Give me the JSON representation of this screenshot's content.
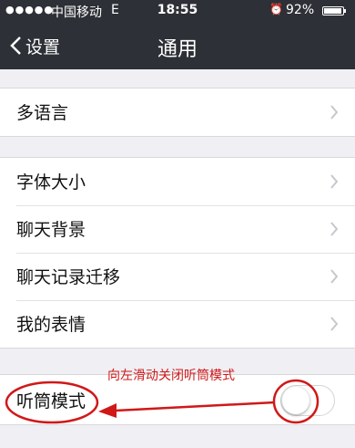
{
  "status_bar": {
    "signal": "●●●●●",
    "carrier": "中国移动",
    "network": "E",
    "time": "18:55",
    "alarm_icon": "alarm-clock-icon",
    "battery_percent": "92%",
    "battery_level": 0.92
  },
  "nav": {
    "back_label": "设置",
    "title": "通用"
  },
  "groups": [
    {
      "items": [
        {
          "label": "多语言"
        }
      ]
    },
    {
      "items": [
        {
          "label": "字体大小"
        },
        {
          "label": "聊天背景"
        },
        {
          "label": "聊天记录迁移"
        },
        {
          "label": "我的表情"
        }
      ]
    },
    {
      "items": [
        {
          "label": "听筒模式",
          "toggle_on": false
        }
      ]
    }
  ],
  "annotation": {
    "text": "向左滑动关闭听筒模式",
    "color": "#d01818"
  }
}
